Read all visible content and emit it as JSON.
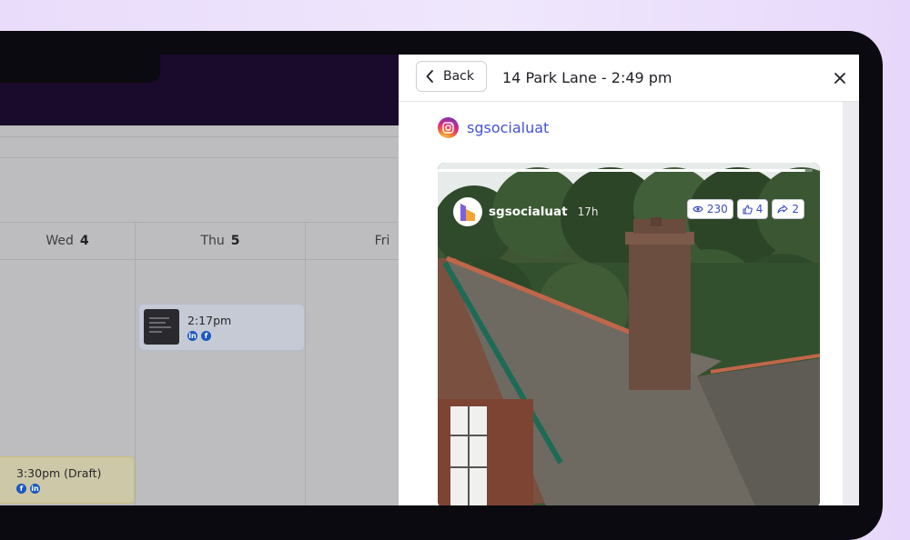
{
  "calendar": {
    "days": [
      {
        "name": "Wed",
        "num": "4"
      },
      {
        "name": "Thu",
        "num": "5"
      },
      {
        "name": "Fri",
        "num": ""
      }
    ],
    "events": [
      {
        "time": "2:17pm",
        "networks": [
          "linkedin",
          "facebook"
        ]
      },
      {
        "time": "3:30pm (Draft)",
        "networks": [
          "facebook",
          "linkedin"
        ]
      }
    ]
  },
  "panel": {
    "back_label": "Back",
    "title": "14 Park Lane - 2:49 pm",
    "account": {
      "network_icon": "instagram-icon",
      "name": "sgsocialuat"
    },
    "story": {
      "username": "sgsocialuat",
      "time_ago": "17h",
      "progress": 0.98,
      "metrics": {
        "views": "230",
        "likes": "4",
        "shares": "2"
      }
    }
  },
  "colors": {
    "accent": "#4452d9",
    "topbar": "#1a0a2b",
    "facebook": "#1c58c2"
  }
}
